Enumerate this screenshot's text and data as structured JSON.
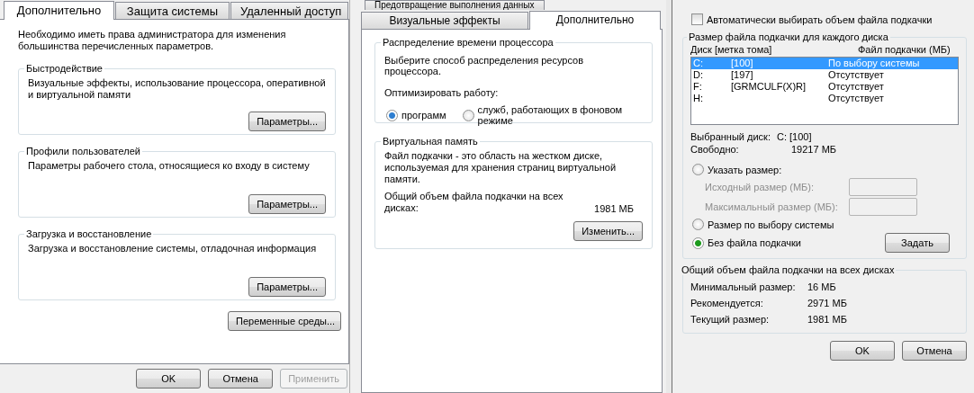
{
  "system_properties": {
    "tabs": [
      {
        "label": "Дополнительно",
        "selected": true
      },
      {
        "label": "Защита системы",
        "selected": false
      },
      {
        "label": "Удаленный доступ",
        "selected": false
      }
    ],
    "admin_note": "Необходимо иметь права администратора для изменения большинства перечисленных параметров.",
    "groups": [
      {
        "title": "Быстродействие",
        "description": "Визуальные эффекты, использование процессора, оперативной и виртуальной памяти",
        "button": {
          "label": "Параметры..."
        }
      },
      {
        "title": "Профили пользователей",
        "description": "Параметры рабочего стола, относящиеся ко входу в систему",
        "button": {
          "label": "Параметры..."
        }
      },
      {
        "title": "Загрузка и восстановление",
        "description": "Загрузка и восстановление системы, отладочная информация",
        "button": {
          "label": "Параметры..."
        }
      }
    ],
    "env_button": "Переменные среды...",
    "buttons": [
      {
        "label": "OK",
        "disabled": false
      },
      {
        "label": "Отмена",
        "disabled": false
      },
      {
        "label": "Применить",
        "disabled": true
      }
    ]
  },
  "performance_options": {
    "tabs_top": [
      {
        "label": "Предотвращение выполнения данных",
        "selected": false
      }
    ],
    "tabs": [
      {
        "label": "Визуальные эффекты",
        "selected": false
      },
      {
        "label": "Дополнительно",
        "selected": true
      }
    ],
    "processor_group": {
      "title": "Распределение времени процессора",
      "prompt": "Выберите способ распределения ресурсов процессора.",
      "optimize_label": "Оптимизировать работу:",
      "options": [
        {
          "label": "программ",
          "selected": true
        },
        {
          "label": "служб, работающих в фоновом режиме",
          "selected": false
        }
      ]
    },
    "virtual_memory_group": {
      "title": "Виртуальная память",
      "description": "Файл подкачки - это область на жестком диске, используемая для хранения страниц виртуальной памяти.",
      "total_label": "Общий объем файла подкачки на всех дисках:",
      "total_value": "1981 МБ",
      "button": {
        "label": "Изменить..."
      }
    }
  },
  "virtual_memory": {
    "auto_checkbox": {
      "label": "Автоматически выбирать объем файла подкачки",
      "checked": false
    },
    "drives_group": {
      "title": "Размер файла подкачки для каждого диска",
      "columns": [
        "Диск [метка тома]",
        "Файл подкачки (МБ)"
      ],
      "rows": [
        {
          "drive": "C:",
          "volume": "[100]",
          "paging_file": "По выбору системы",
          "selected": true
        },
        {
          "drive": "D:",
          "volume": "[197]",
          "paging_file": "Отсутствует",
          "selected": false
        },
        {
          "drive": "F:",
          "volume": "[GRMCULF(X)R]",
          "paging_file": "Отсутствует",
          "selected": false
        },
        {
          "drive": "H:",
          "volume": "",
          "paging_file": "Отсутствует",
          "selected": false
        }
      ],
      "selected_drive_label": "Выбранный диск:",
      "selected_drive_value": "C:  [100]",
      "free_label": "Свободно:",
      "free_value": "19217 МБ",
      "options": [
        {
          "kind": "custom",
          "label": "Указать размер:",
          "selected": false,
          "fields": [
            {
              "label": "Исходный размер (МБ):",
              "disabled": true
            },
            {
              "label": "Максимальный размер (МБ):",
              "disabled": true
            }
          ]
        },
        {
          "kind": "plain",
          "label": "Размер по выбору системы",
          "selected": false
        },
        {
          "kind": "plain",
          "label": "Без файла подкачки",
          "selected": true
        }
      ],
      "set_button": {
        "label": "Задать"
      }
    },
    "totals_group": {
      "title": "Общий объем файла подкачки на всех дисках",
      "rows": [
        {
          "label": "Минимальный размер:",
          "value": "16 МБ"
        },
        {
          "label": "Рекомендуется:",
          "value": "2971 МБ"
        },
        {
          "label": "Текущий размер:",
          "value": "1981 МБ"
        }
      ]
    },
    "buttons": [
      {
        "label": "OK",
        "disabled": false
      },
      {
        "label": "Отмена",
        "disabled": false
      }
    ]
  }
}
